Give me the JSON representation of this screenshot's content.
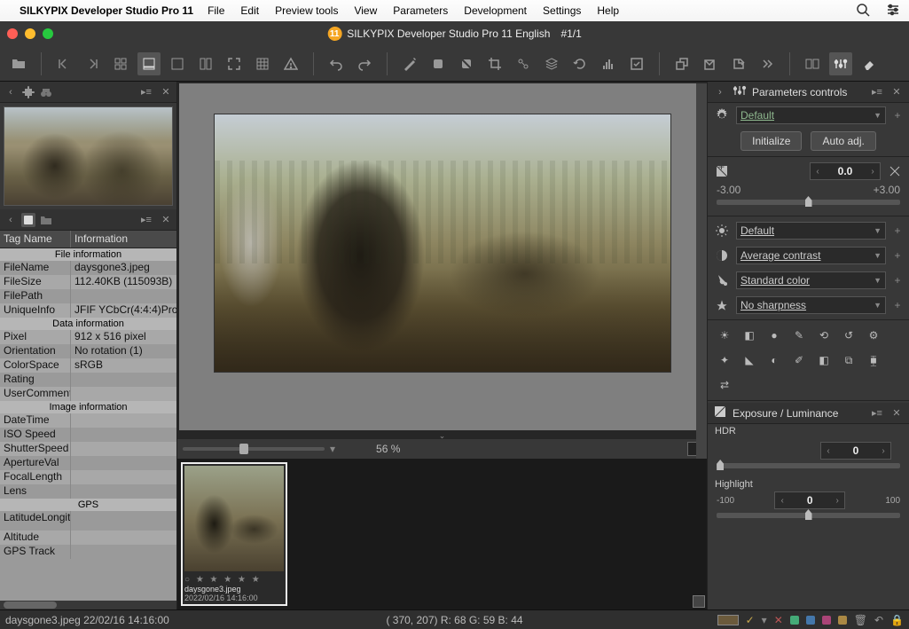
{
  "menubar": {
    "app_name": "SILKYPIX Developer Studio Pro 11",
    "items": [
      "File",
      "Edit",
      "Preview tools",
      "View",
      "Parameters",
      "Development",
      "Settings",
      "Help"
    ]
  },
  "window": {
    "title": "SILKYPIX Developer Studio Pro 11 English",
    "counter": "#1/1"
  },
  "metadata": {
    "col_tag": "Tag Name",
    "col_info": "Information",
    "sections": {
      "file": "File information",
      "data": "Data information",
      "image": "Image information",
      "gps": "GPS"
    },
    "rows": {
      "FileName": "daysgone3.jpeg",
      "FileSize": "112.40KB (115093B)",
      "FilePath": "",
      "UniqueInfo": "JFIF YCbCr(4:4:4)Pro",
      "Pixel": "912 x 516 pixel",
      "Orientation": "No rotation (1)",
      "ColorSpace": "sRGB",
      "Rating": "",
      "UserComment": "",
      "DateTime": "",
      "ISO Speed": "",
      "ShutterSpeed": "",
      "ApertureVal": "",
      "FocalLength": "",
      "Lens": "",
      "LatitudeLongit": "",
      "Altitude": "",
      "GPS Track": ""
    }
  },
  "zoom": {
    "percent": "56 %"
  },
  "filmstrip": {
    "items": [
      {
        "name": "daysgone3.jpeg",
        "date": "2022/02/16 14:16:00",
        "stars": "○ ★ ★ ★ ★ ★"
      }
    ]
  },
  "right": {
    "panel_title": "Parameters controls",
    "preset": "Default",
    "btn_init": "Initialize",
    "btn_auto": "Auto adj.",
    "ev_value": "0.0",
    "ev_min": "-3.00",
    "ev_max": "+3.00",
    "wb": "Default",
    "contrast": "Average contrast",
    "color": "Standard color",
    "sharp": "No sharpness",
    "exp_title": "Exposure / Luminance",
    "hdr_label": "HDR",
    "hdr_value": "0",
    "highlight_label": "Highlight",
    "highlight_value": "0",
    "highlight_min": "-100",
    "highlight_max": "100"
  },
  "status": {
    "left": "daysgone3.jpeg 22/02/16 14:16:00",
    "center": "( 370, 207) R: 68 G: 59 B: 44"
  }
}
